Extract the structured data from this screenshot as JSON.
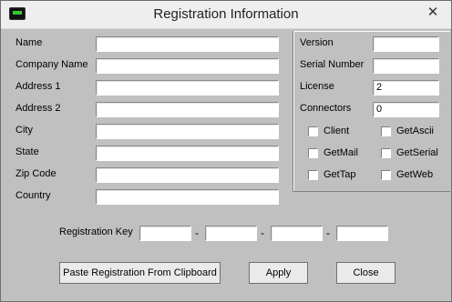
{
  "window": {
    "title": "Registration Information",
    "close": "✕"
  },
  "left_fields": [
    {
      "label": "Name",
      "value": ""
    },
    {
      "label": "Company Name",
      "value": ""
    },
    {
      "label": "Address 1",
      "value": ""
    },
    {
      "label": "Address 2",
      "value": ""
    },
    {
      "label": "City",
      "value": ""
    },
    {
      "label": "State",
      "value": ""
    },
    {
      "label": "Zip Code",
      "value": ""
    },
    {
      "label": "Country",
      "value": ""
    }
  ],
  "right_fields": [
    {
      "label": "Version",
      "value": ""
    },
    {
      "label": "Serial Number",
      "value": ""
    },
    {
      "label": "License",
      "value": "2"
    },
    {
      "label": "Connectors",
      "value": "0"
    }
  ],
  "checkboxes": [
    {
      "label": "Client",
      "checked": false
    },
    {
      "label": "GetAscii",
      "checked": false
    },
    {
      "label": "GetMail",
      "checked": false
    },
    {
      "label": "GetSerial",
      "checked": false
    },
    {
      "label": "GetTap",
      "checked": false
    },
    {
      "label": "GetWeb",
      "checked": false
    }
  ],
  "registration": {
    "label": "Registration Key",
    "parts": [
      "",
      "",
      "",
      ""
    ],
    "separator": "-"
  },
  "buttons": {
    "paste": "Paste Registration From Clipboard",
    "apply": "Apply",
    "close": "Close"
  },
  "colors": {
    "dialog_bg": "#c0c0c0",
    "titlebar_bg": "#eeeeee",
    "field_bg": "#ffffff"
  }
}
